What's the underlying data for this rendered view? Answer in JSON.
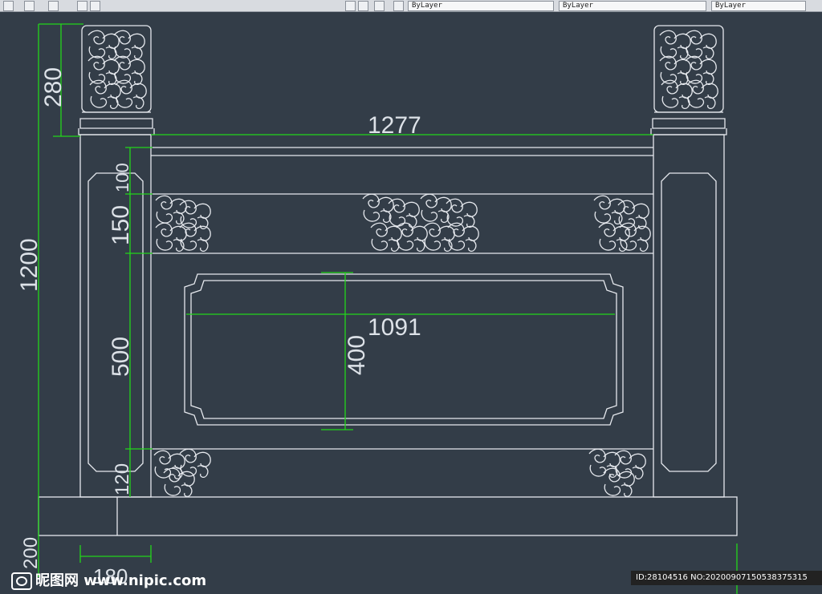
{
  "toolbar": {
    "fields": [
      "ByLayer",
      "ByLayer",
      "ByLayer"
    ]
  },
  "drawing": {
    "dimensions": {
      "total_height": "1200",
      "post_cap": "280",
      "overall_width": "1277",
      "top_rail": "150",
      "rail_gap": "100",
      "panel_height": "500",
      "bottom_rail": "120",
      "base_height": "200",
      "post_width": "180",
      "center_panel_width": "1091",
      "center_panel_height": "400"
    },
    "colors": {
      "background": "#333d48",
      "lines": "#e6e9ee",
      "dimension": "#22d61a"
    }
  },
  "watermark": {
    "site": "昵图网 www.nipic.com",
    "id_text": "ID:28104516 NO:20200907150538375315"
  }
}
